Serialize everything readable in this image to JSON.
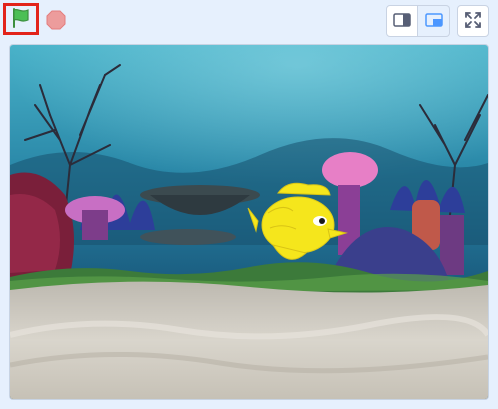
{
  "toolbar": {
    "green_flag": {
      "icon": "green-flag-icon",
      "color": "#4cbf56",
      "highlight": "#e2231a"
    },
    "stop": {
      "icon": "stop-sign-icon",
      "color": "#ec9c9c"
    },
    "small_stage": {
      "icon": "small-stage-icon"
    },
    "large_stage": {
      "icon": "large-stage-icon",
      "selected": true,
      "accent": "#4c97ff"
    },
    "full_screen": {
      "icon": "full-screen-icon"
    }
  },
  "stage": {
    "backdrop": "underwater",
    "sprite": "yellow-fish",
    "colors": {
      "water_top": "#3fa7c2",
      "water_mid": "#1d6f8e",
      "sand": "#cfcbc2",
      "fish": "#f5e61c"
    }
  }
}
